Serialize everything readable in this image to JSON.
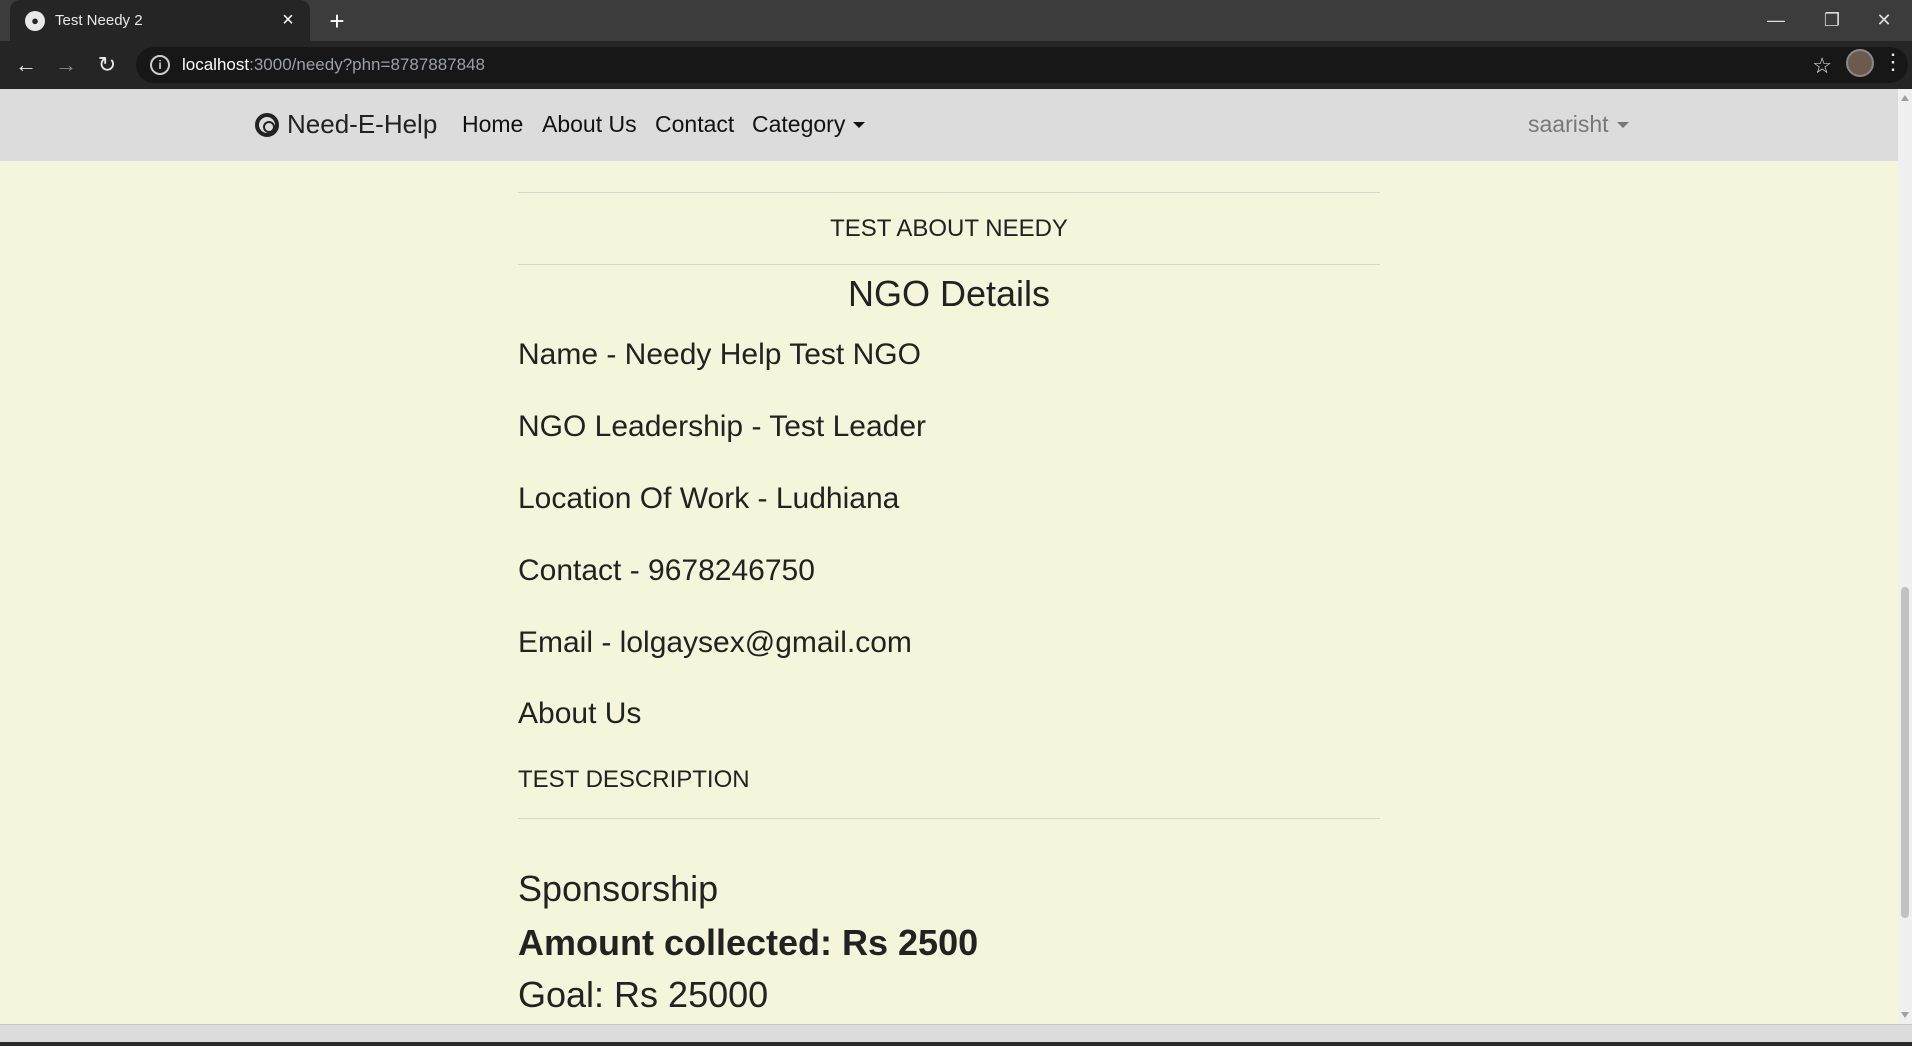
{
  "browser": {
    "tab_title": "Test Needy 2",
    "tab_close": "×",
    "new_tab": "+",
    "url_host": "localhost",
    "url_path": ":3000/needy?phn=8787887848",
    "window_controls": {
      "minimize": "—",
      "restore": "❐",
      "close": "✕"
    }
  },
  "navbar": {
    "brand": "Need-E-Help",
    "links": [
      "Home",
      "About Us",
      "Contact",
      "Category"
    ],
    "user": "saarisht"
  },
  "content": {
    "about_needy": "TEST ABOUT NEEDY",
    "ngo_title": "NGO Details",
    "name": "Name - Needy Help Test NGO",
    "leadership": "NGO Leadership - Test Leader",
    "location": "Location Of Work - Ludhiana",
    "contact": "Contact - 9678246750",
    "email": "Email - lolgaysex@gmail.com",
    "about_us": "About Us",
    "description": "TEST DESCRIPTION",
    "sponsorship": "Sponsorship",
    "amount_collected": "Amount collected: Rs 2500",
    "goal": "Goal: Rs 25000"
  }
}
